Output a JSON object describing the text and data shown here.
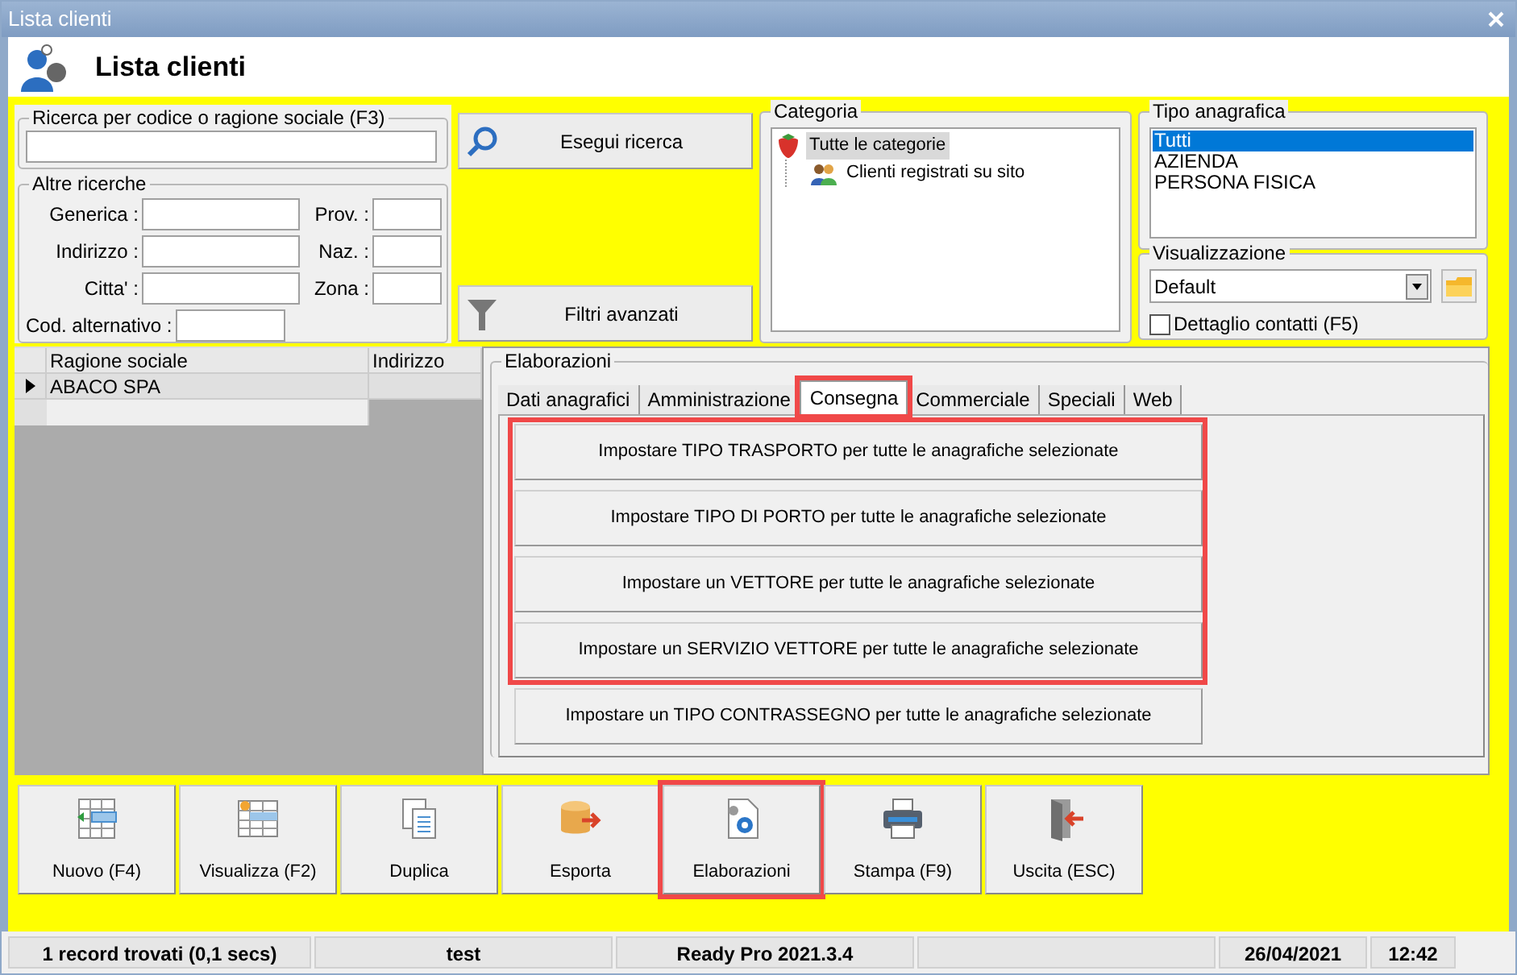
{
  "window": {
    "title": "Lista clienti",
    "header": "Lista clienti"
  },
  "search": {
    "legend": "Ricerca per codice o ragione sociale (F3)"
  },
  "other_searches": {
    "legend": "Altre ricerche",
    "left": [
      {
        "label": "Generica :"
      },
      {
        "label": "Indirizzo :"
      },
      {
        "label": "Citta' :"
      }
    ],
    "right": [
      {
        "label": "Prov. :"
      },
      {
        "label": "Naz. :"
      },
      {
        "label": "Zona :"
      }
    ],
    "extra": {
      "label": "Cod. alternativo :"
    }
  },
  "search_buttons": [
    {
      "kind": "search",
      "label": "Esegui ricerca"
    },
    {
      "kind": "filter",
      "label": "Filtri avanzati"
    }
  ],
  "category": {
    "legend": "Categoria",
    "tree": [
      {
        "label": "Tutte le categorie",
        "selected": true,
        "children": [
          {
            "label": "Clienti registrati su sito",
            "selected": false
          }
        ]
      }
    ]
  },
  "registry_type": {
    "legend": "Tipo anagrafica",
    "items": [
      {
        "label": "Tutti",
        "selected": true
      },
      {
        "label": "AZIENDA",
        "selected": false
      },
      {
        "label": "PERSONA FISICA",
        "selected": false
      }
    ]
  },
  "view": {
    "legend": "Visualizzazione",
    "value": "Default",
    "checkbox": {
      "label": "Dettaglio contatti (F5)",
      "checked": false
    }
  },
  "table": {
    "columns": [
      "Ragione sociale",
      "Indirizzo"
    ],
    "rows": [
      {
        "cells": [
          "ABACO SPA"
        ],
        "current": true
      }
    ]
  },
  "processing": {
    "legend": "Elaborazioni",
    "tabs": [
      {
        "label": "Dati anagrafici",
        "selected": false,
        "highlighted": false
      },
      {
        "label": "Amministrazione",
        "selected": false,
        "highlighted": false
      },
      {
        "label": "Consegna",
        "selected": true,
        "highlighted": true
      },
      {
        "label": "Commerciale",
        "selected": false,
        "highlighted": false
      },
      {
        "label": "Speciali",
        "selected": false,
        "highlighted": false
      },
      {
        "label": "Web",
        "selected": false,
        "highlighted": false
      }
    ],
    "action_groups": [
      {
        "highlighted": true,
        "buttons": [
          "Impostare TIPO TRASPORTO per tutte le anagrafiche selezionate",
          "Impostare TIPO DI PORTO per tutte le anagrafiche selezionate",
          "Impostare un VETTORE per tutte le anagrafiche selezionate",
          "Impostare un SERVIZIO VETTORE per tutte le anagrafiche selezionate"
        ]
      },
      {
        "highlighted": false,
        "buttons": [
          "Impostare un TIPO CONTRASSEGNO per tutte le anagrafiche selezionate"
        ]
      }
    ]
  },
  "toolbar": [
    {
      "kind": "new",
      "label": "Nuovo (F4)",
      "highlighted": false
    },
    {
      "kind": "view",
      "label": "Visualizza (F2)",
      "highlighted": false
    },
    {
      "kind": "duplicate",
      "label": "Duplica",
      "highlighted": false
    },
    {
      "kind": "export",
      "label": "Esporta",
      "highlighted": false
    },
    {
      "kind": "process",
      "label": "Elaborazioni",
      "highlighted": true
    },
    {
      "kind": "print",
      "label": "Stampa (F9)",
      "highlighted": false
    },
    {
      "kind": "exit",
      "label": "Uscita (ESC)",
      "highlighted": false
    }
  ],
  "status_bar": {
    "left": [
      "1 record trovati (0,1 secs)",
      "test",
      "Ready Pro 2021.3.4"
    ],
    "right": [
      "26/04/2021",
      "12:42"
    ]
  }
}
